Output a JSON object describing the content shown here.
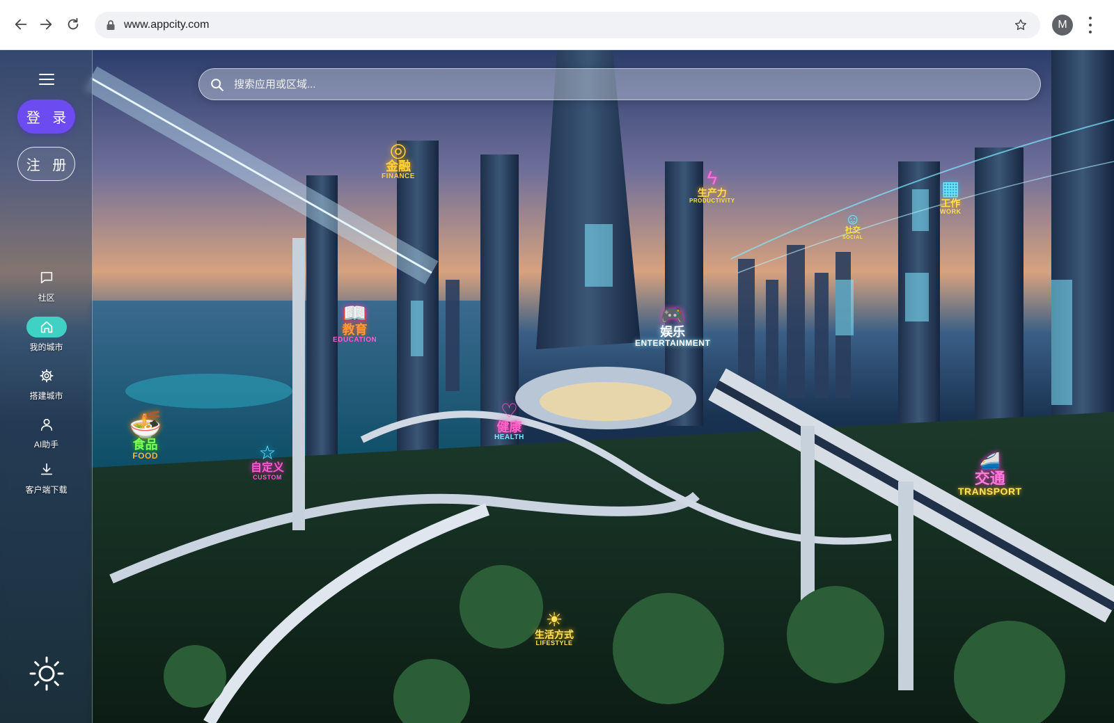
{
  "browser": {
    "url": "www.appcity.com",
    "profile_initial": "M",
    "icons": {
      "back": "back-arrow-icon",
      "forward": "forward-arrow-icon",
      "reload": "reload-icon",
      "lock": "lock-icon",
      "bookmark": "star-icon",
      "menu": "more-vert-icon"
    }
  },
  "sidebar": {
    "login_label": "登 录",
    "register_label": "注 册",
    "items": [
      {
        "label": "社区",
        "icon": "chat-icon"
      },
      {
        "label": "我的城市",
        "icon": "home-icon",
        "active": true
      },
      {
        "label": "搭建城市",
        "icon": "gear-icon"
      },
      {
        "label": "AI助手",
        "icon": "person-icon"
      },
      {
        "label": "客户端下载",
        "icon": "download-icon"
      }
    ],
    "theme_icon": "sun-icon",
    "active_color": "#3fd2c4",
    "login_color": "#6c4cf0"
  },
  "search": {
    "placeholder": "搜索应用或区域..."
  },
  "districts": [
    {
      "zh": "金融",
      "en": "FINANCE",
      "color": "#ffd23a"
    },
    {
      "zh": "生产力",
      "en": "PRODUCTIVITY",
      "color": "#ff6fd8"
    },
    {
      "zh": "工作",
      "en": "WORK",
      "color": "#ffe14a"
    },
    {
      "zh": "社交",
      "en": "SOCIAL",
      "color": "#7fe7ff"
    },
    {
      "zh": "教育",
      "en": "EDUCATION",
      "color": "#ff5fd0"
    },
    {
      "zh": "娱乐",
      "en": "ENTERTAINMENT",
      "color": "#ffffff"
    },
    {
      "zh": "健康",
      "en": "HEALTH",
      "color": "#ff66c8"
    },
    {
      "zh": "食品",
      "en": "FOOD",
      "color": "#ffb52e"
    },
    {
      "zh": "自定义",
      "en": "CUSTOM",
      "color": "#ff5ad6"
    },
    {
      "zh": "交通",
      "en": "TRANSPORT",
      "color": "#ff7ad9"
    },
    {
      "zh": "生活方式",
      "en": "LIFESTYLE",
      "color": "#ffe45a"
    }
  ]
}
